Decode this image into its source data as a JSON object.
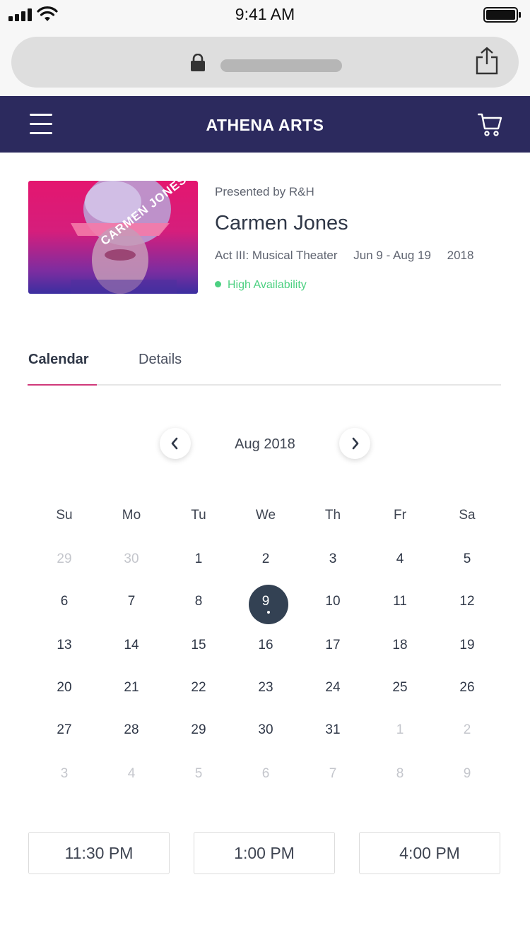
{
  "status_bar": {
    "time": "9:41 AM"
  },
  "header": {
    "brand": "ATHENA ARTS",
    "menu_icon": "hamburger-menu-icon",
    "cart_icon": "cart-icon"
  },
  "show": {
    "presenter": "Presented by R&H",
    "title": "Carmen Jones",
    "poster_text": "CARMEN JONES",
    "category": "Act III: Musical Theater",
    "dates": "Jun 9 - Aug 19",
    "year": "2018",
    "availability": "High Availability",
    "availability_color": "#4cd081"
  },
  "tabs": [
    {
      "label": "Calendar",
      "active": true
    },
    {
      "label": "Details",
      "active": false
    }
  ],
  "calendar": {
    "month_label": "Aug 2018",
    "weekdays": [
      "Su",
      "Mo",
      "Tu",
      "We",
      "Th",
      "Fr",
      "Sa"
    ],
    "weeks": [
      [
        "29",
        "30",
        "1",
        "2",
        "3",
        "4",
        "5"
      ],
      [
        "6",
        "7",
        "8",
        "9",
        "10",
        "11",
        "12"
      ],
      [
        "13",
        "14",
        "15",
        "16",
        "17",
        "18",
        "19"
      ],
      [
        "20",
        "21",
        "22",
        "23",
        "24",
        "25",
        "26"
      ],
      [
        "27",
        "28",
        "29",
        "30",
        "31",
        "1",
        "2"
      ],
      [
        "3",
        "4",
        "5",
        "6",
        "7",
        "8",
        "9"
      ]
    ],
    "selected_day": "9",
    "accent_color": "#d0397a",
    "selected_color": "#334153"
  },
  "times": [
    "11:30 PM",
    "1:00 PM",
    "4:00 PM"
  ],
  "colors": {
    "navbar": "#2c2a5e",
    "text": "#2f3747"
  }
}
